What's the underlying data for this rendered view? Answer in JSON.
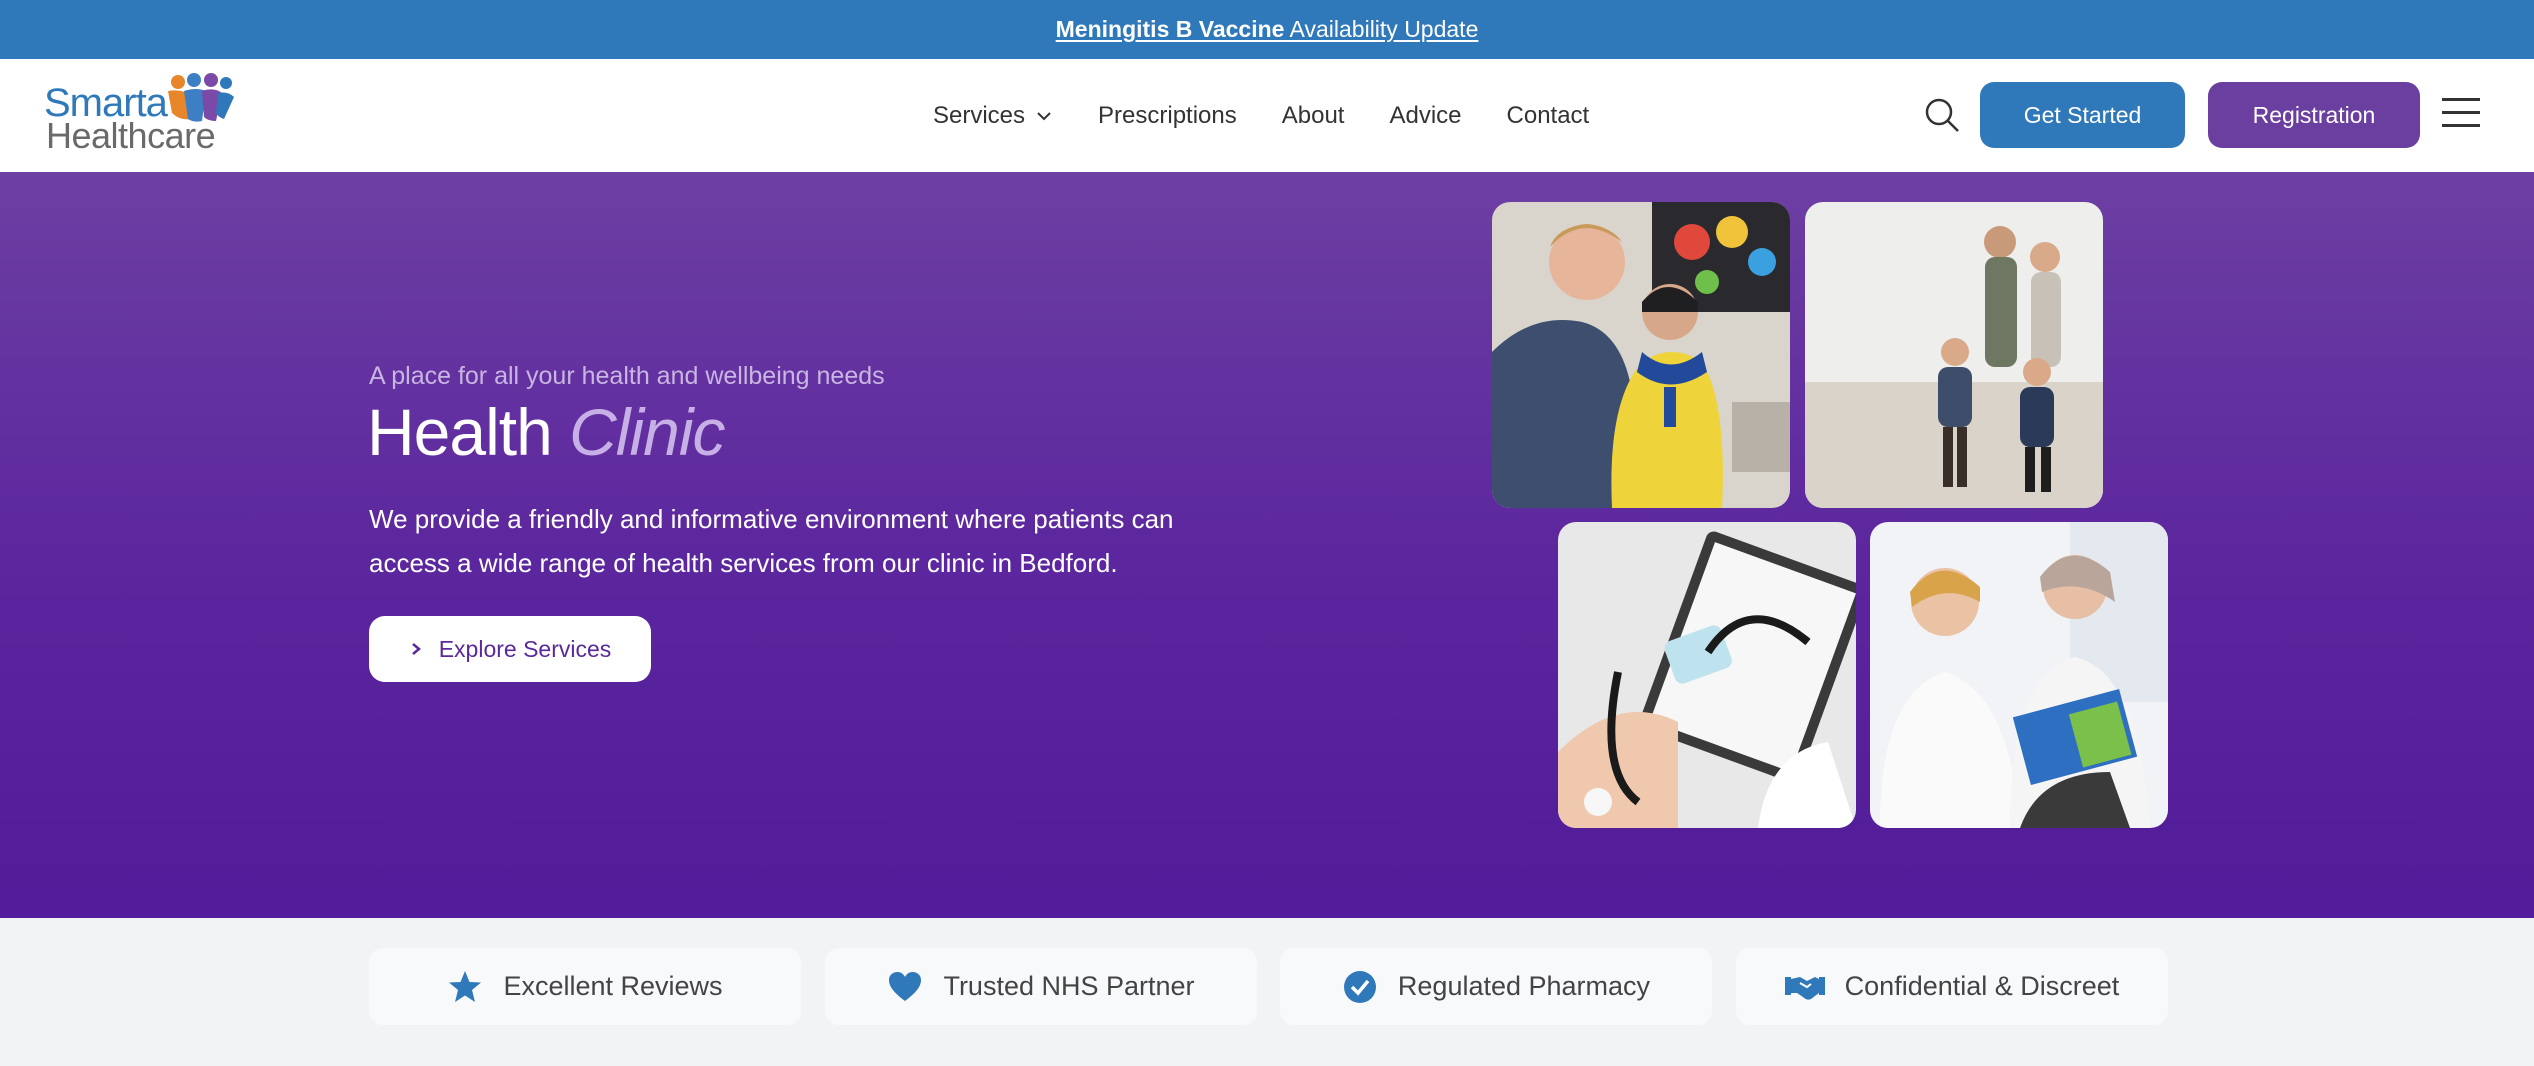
{
  "announcement": {
    "bold": "Meningitis B Vaccine",
    "rest": " Availability Update"
  },
  "logo": {
    "line1": "Smarta",
    "line2": "Healthcare"
  },
  "nav": [
    {
      "label": "Services",
      "has_dropdown": true
    },
    {
      "label": "Prescriptions"
    },
    {
      "label": "About"
    },
    {
      "label": "Advice"
    },
    {
      "label": "Contact"
    }
  ],
  "header": {
    "get_started": "Get Started",
    "registration": "Registration"
  },
  "hero": {
    "tagline": "A place for all your health and wellbeing needs",
    "title_main": "Health",
    "title_accent": "Clinic",
    "description": "We provide a friendly and informative environment where patients can access a wide range of health services from our clinic in Bedford.",
    "cta": "Explore Services"
  },
  "trust": [
    {
      "label": "Excellent Reviews",
      "icon": "star-icon"
    },
    {
      "label": "Trusted NHS Partner",
      "icon": "heart-icon"
    },
    {
      "label": "Regulated Pharmacy",
      "icon": "check-circle-icon"
    },
    {
      "label": "Confidential & Discreet",
      "icon": "handshake-icon"
    }
  ],
  "colors": {
    "primary_blue": "#2f79ba",
    "primary_purple": "#6a3fa0",
    "hero_purple": "#5b259e"
  }
}
